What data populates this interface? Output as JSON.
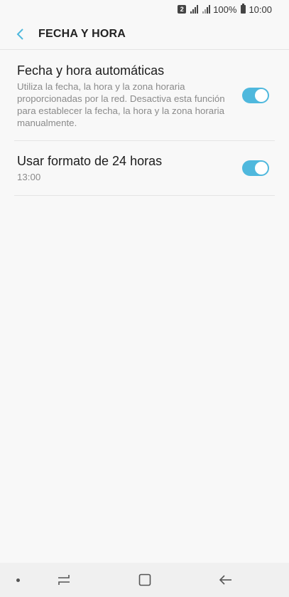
{
  "status_bar": {
    "sim_slot": "2",
    "battery_percent": "100%",
    "time": "10:00"
  },
  "app_bar": {
    "title": "FECHA Y HORA"
  },
  "settings": {
    "auto_datetime": {
      "title": "Fecha y hora automáticas",
      "summary": "Utiliza la fecha, la hora y la zona horaria proporcionadas por la red. Desactiva esta función para establecer la fecha, la hora y la zona horaria manualmente.",
      "enabled": true
    },
    "format_24h": {
      "title": "Usar formato de 24 horas",
      "summary": "13:00",
      "enabled": true
    }
  },
  "colors": {
    "accent": "#4fb8dd",
    "background": "#f8f8f8",
    "divider": "#e4e4e4"
  },
  "icons": {
    "back": "chevron-left-icon",
    "nav_recent": "recent-apps-icon",
    "nav_home": "home-icon",
    "nav_back": "back-arrow-icon"
  }
}
